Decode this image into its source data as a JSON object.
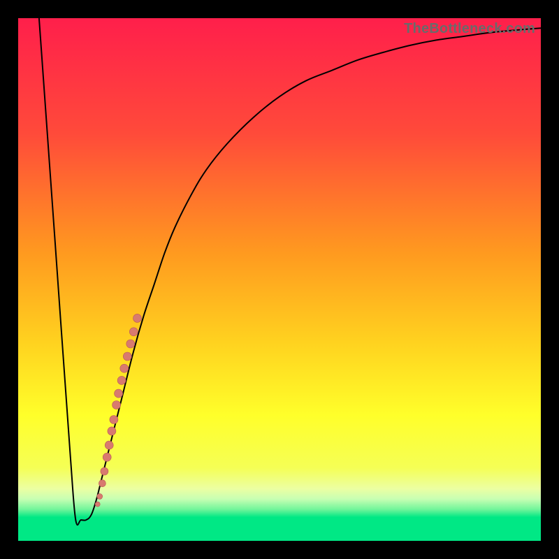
{
  "attribution": "TheBottleneck.com",
  "colors": {
    "frame": "#000000",
    "curve": "#000000",
    "dot_fill": "#d87a6f",
    "dot_stroke": "#b85a52",
    "gradient_stops": [
      {
        "offset": 0.0,
        "color": "#ff1f4b"
      },
      {
        "offset": 0.22,
        "color": "#ff4a3a"
      },
      {
        "offset": 0.45,
        "color": "#ff9a1f"
      },
      {
        "offset": 0.62,
        "color": "#ffd21f"
      },
      {
        "offset": 0.76,
        "color": "#ffff2a"
      },
      {
        "offset": 0.86,
        "color": "#f5ff55"
      },
      {
        "offset": 0.9,
        "color": "#ecffa2"
      },
      {
        "offset": 0.92,
        "color": "#c7ffb3"
      },
      {
        "offset": 0.94,
        "color": "#70f59a"
      },
      {
        "offset": 0.955,
        "color": "#00e885"
      },
      {
        "offset": 1.0,
        "color": "#00e885"
      }
    ]
  },
  "chart_data": {
    "type": "line",
    "title": "",
    "xlabel": "",
    "ylabel": "",
    "xlim": [
      0,
      100
    ],
    "ylim": [
      0,
      100
    ],
    "grid": false,
    "series": [
      {
        "name": "bottleneck-curve",
        "x": [
          4,
          6,
          8,
          10,
          11,
          12,
          13,
          14,
          15,
          16,
          18,
          20,
          22,
          24,
          26,
          28,
          30,
          33,
          36,
          40,
          45,
          50,
          55,
          60,
          65,
          70,
          75,
          80,
          85,
          90,
          95,
          100
        ],
        "y": [
          100,
          72,
          44,
          16,
          4,
          4,
          4,
          5,
          8,
          12,
          20,
          28,
          36,
          43,
          49,
          55,
          60,
          66,
          71,
          76,
          81,
          85,
          88,
          90,
          92,
          93.5,
          94.8,
          95.8,
          96.5,
          97.2,
          97.7,
          98.1
        ]
      }
    ],
    "points": {
      "name": "highlight-dots",
      "x": [
        15.2,
        15.6,
        16.1,
        16.5,
        17.0,
        17.4,
        17.9,
        18.3,
        18.8,
        19.2,
        19.8,
        20.3,
        20.9,
        21.5,
        22.1,
        22.8
      ],
      "y": [
        7.0,
        8.5,
        11.0,
        13.3,
        16.0,
        18.3,
        21.0,
        23.2,
        26.0,
        28.2,
        30.7,
        33.0,
        35.3,
        37.7,
        40.0,
        42.6
      ],
      "r": [
        3.5,
        4.0,
        5.0,
        5.5,
        6.0,
        6.0,
        6.0,
        6.0,
        6.0,
        6.0,
        6.0,
        6.0,
        6.0,
        6.0,
        6.0,
        6.0
      ]
    }
  }
}
